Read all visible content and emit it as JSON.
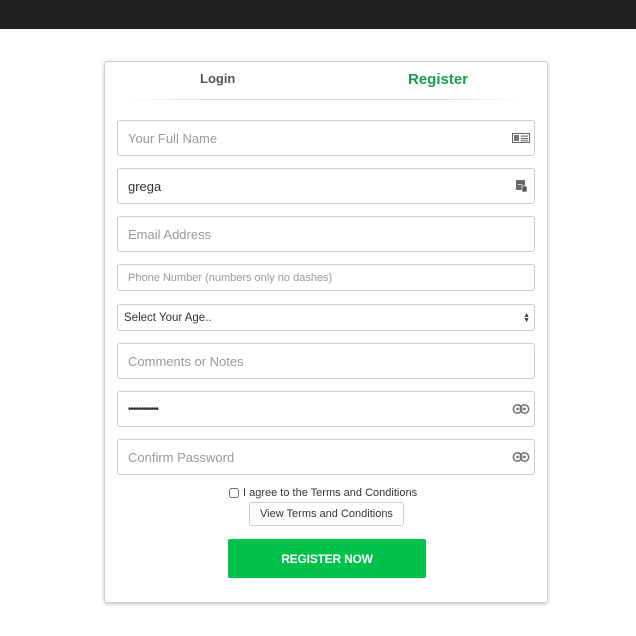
{
  "tabs": {
    "login": "Login",
    "register": "Register",
    "active": "register",
    "active_color": "#1a9e4b"
  },
  "form": {
    "full_name": {
      "placeholder": "Your Full Name",
      "value": "",
      "icon": "id-card-icon"
    },
    "username": {
      "placeholder": "",
      "value": "grega",
      "icon": "user-badge-icon"
    },
    "email": {
      "placeholder": "Email Address",
      "value": ""
    },
    "phone": {
      "placeholder": "Phone Number (numbers only no dashes)",
      "value": ""
    },
    "age_select": {
      "selected": "Select Your Age.."
    },
    "comments": {
      "placeholder": "Comments or Notes",
      "value": ""
    },
    "password": {
      "placeholder": "",
      "value": "••••••••••••",
      "icon": "password-eye-icon"
    },
    "confirm_password": {
      "placeholder": "Confirm Password",
      "value": "",
      "icon": "password-eye-icon"
    },
    "agree_label": "I agree to the Terms and Conditions",
    "agree_checked": false,
    "view_terms_label": "View Terms and Conditions",
    "submit_label": "REGISTER NOW",
    "submit_color": "#00c14a"
  }
}
